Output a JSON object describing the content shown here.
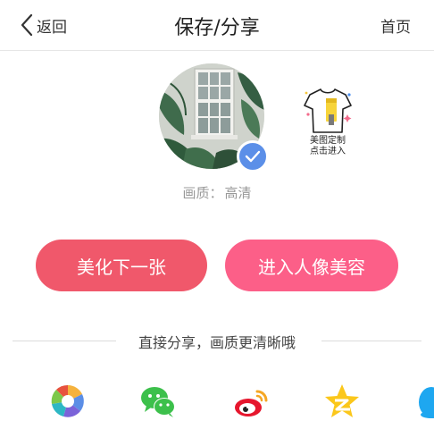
{
  "nav": {
    "back_label": "返回",
    "title": "保存/分享",
    "home_label": "首页"
  },
  "photo": {
    "quality_label": "画质：",
    "quality_value": "高清"
  },
  "promo": {
    "line1": "美图定制",
    "line2": "点击进入"
  },
  "actions": {
    "beautify_next": "美化下一张",
    "portrait_beauty": "进入人像美容"
  },
  "share": {
    "caption": "直接分享，画质更清晰哦",
    "targets": [
      "moments-icon",
      "wechat-icon",
      "weibo-icon",
      "qzone-icon",
      "qq-icon"
    ]
  },
  "colors": {
    "primary_left": "#f0586b",
    "primary_right": "#fc5f88",
    "check_blue": "#5b8fe8"
  }
}
